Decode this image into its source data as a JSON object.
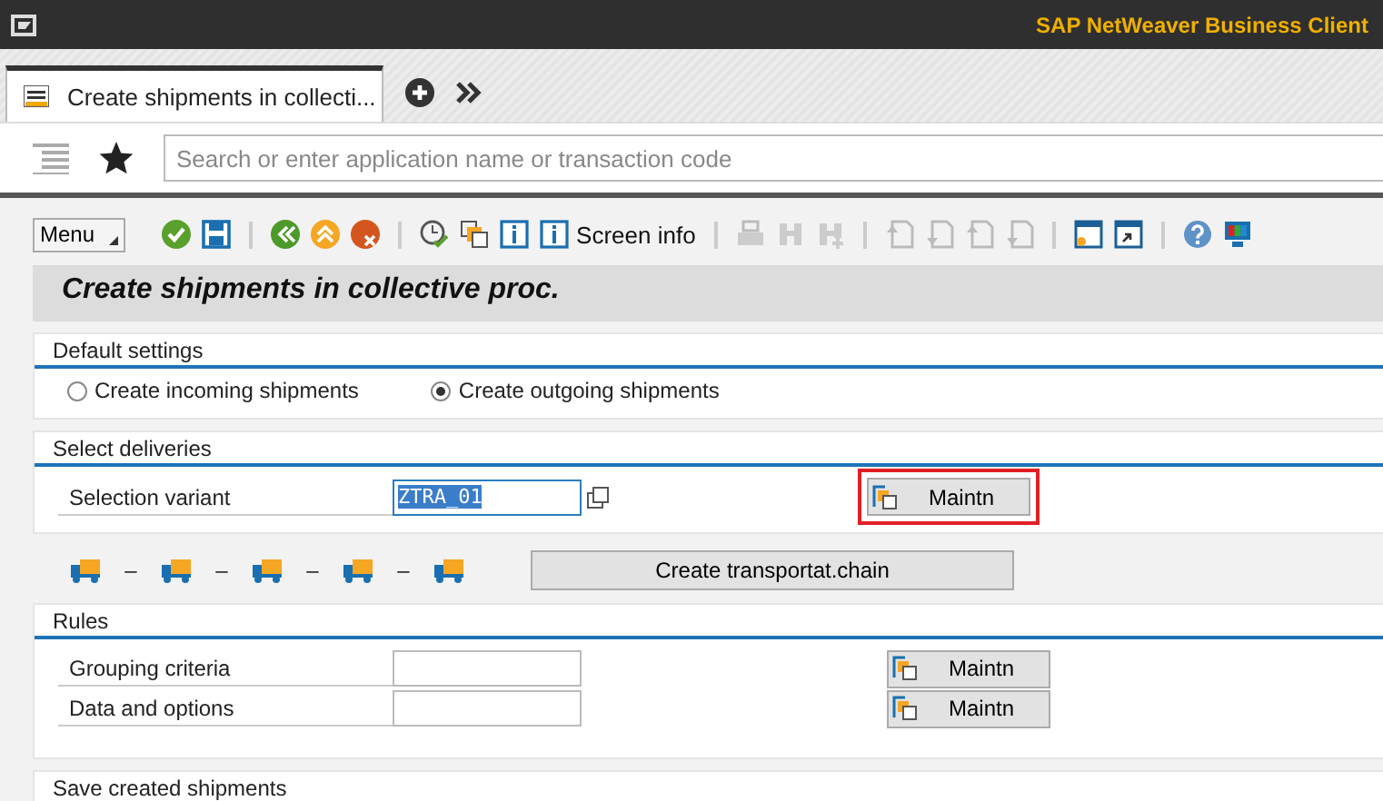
{
  "window": {
    "title": "SAP NetWeaver Business Client"
  },
  "tabs": [
    {
      "label": "Create shipments in collecti...",
      "selected": true
    }
  ],
  "search": {
    "placeholder": "Search or enter application name or transaction code"
  },
  "toolbar": {
    "menu": "Menu",
    "screen_info": "Screen info"
  },
  "page_title": "Create shipments in collective proc.",
  "default_settings": {
    "title": "Default settings",
    "options": [
      {
        "label": "Create incoming shipments",
        "selected": false
      },
      {
        "label": "Create outgoing shipments",
        "selected": true
      }
    ]
  },
  "select_deliveries": {
    "title": "Select deliveries",
    "field": {
      "label": "Selection variant",
      "value": "ZTRA_01",
      "selected": true
    },
    "button": {
      "label": "Maintn",
      "highlighted": true
    }
  },
  "transport_chain": {
    "separators": [
      "–",
      "–",
      "–",
      "–"
    ],
    "button": "Create transportat.chain"
  },
  "rules": {
    "title": "Rules",
    "rows": [
      {
        "label": "Grouping criteria",
        "button": "Maintn"
      },
      {
        "label": "Data and options",
        "button": "Maintn"
      }
    ]
  },
  "save_section": {
    "title": "Save created shipments"
  }
}
